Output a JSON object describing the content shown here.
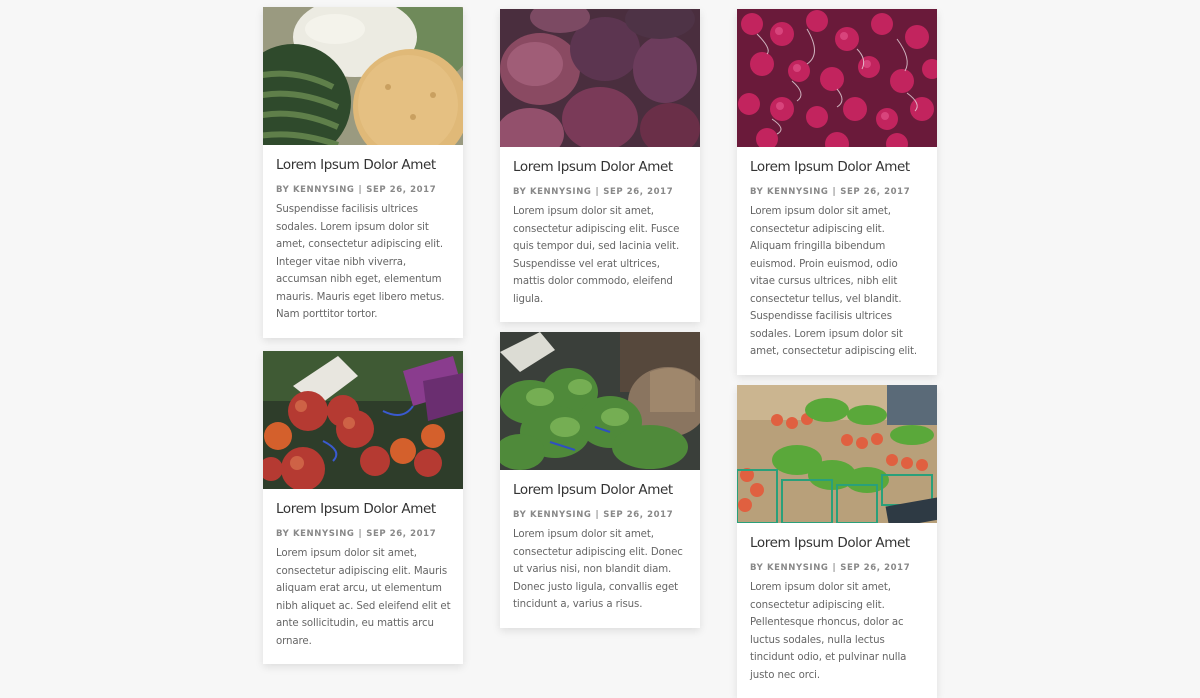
{
  "posts": [
    {
      "image": "melons-photo",
      "title": "Lorem Ipsum Dolor Amet",
      "author_prefix": "BY",
      "author": "KENNYSING",
      "separator": "|",
      "date": "SEP 26, 2017",
      "excerpt": "Suspendisse facilisis ultrices sodales. Lorem ipsum dolor sit amet, consectetur adipiscing elit. Integer vitae nibh viverra, accumsan nibh eget, elementum mauris. Mauris eget libero metus. Nam porttitor tortor."
    },
    {
      "image": "figs-photo",
      "title": "Lorem Ipsum Dolor Amet",
      "author_prefix": "BY",
      "author": "KENNYSING",
      "separator": "|",
      "date": "SEP 26, 2017",
      "excerpt": "Lorem ipsum dolor sit amet, consectetur adipiscing elit. Fusce quis tempor dui, sed lacinia velit. Suspendisse vel erat ultrices, mattis dolor commodo, eleifend ligula."
    },
    {
      "image": "radishes-photo",
      "title": "Lorem Ipsum Dolor Amet",
      "author_prefix": "BY",
      "author": "KENNYSING",
      "separator": "|",
      "date": "SEP 26, 2017",
      "excerpt": "Lorem ipsum dolor sit amet, consectetur adipiscing elit. Aliquam fringilla bibendum euismod. Proin euismod, odio vitae cursus ultrices, nibh elit consectetur tellus, vel blandit. Suspendisse facilisis ultrices sodales. Lorem ipsum dolor sit amet, consectetur adipiscing elit."
    },
    {
      "image": "beets-photo",
      "title": "Lorem Ipsum Dolor Amet",
      "author_prefix": "BY",
      "author": "KENNYSING",
      "separator": "|",
      "date": "SEP 26, 2017",
      "excerpt": "Lorem ipsum dolor sit amet, consectetur adipiscing elit. Mauris aliquam erat arcu, ut elementum nibh aliquet ac. Sed eleifend elit et ante sollicitudin, eu mattis arcu ornare."
    },
    {
      "image": "greens-photo",
      "title": "Lorem Ipsum Dolor Amet",
      "author_prefix": "BY",
      "author": "KENNYSING",
      "separator": "|",
      "date": "SEP 26, 2017",
      "excerpt": "Lorem ipsum dolor sit amet, consectetur adipiscing elit. Donec ut varius nisi, non blandit diam. Donec justo ligula, convallis eget tincidunt a, varius a risus."
    },
    {
      "image": "market-photo",
      "title": "Lorem Ipsum Dolor Amet",
      "author_prefix": "BY",
      "author": "KENNYSING",
      "separator": "|",
      "date": "SEP 26, 2017",
      "excerpt": "Lorem ipsum dolor sit amet, consectetur adipiscing elit. Pellentesque rhoncus, dolor ac luctus sodales, nulla lectus tincidunt odio, et pulvinar nulla justo nec orci."
    }
  ]
}
